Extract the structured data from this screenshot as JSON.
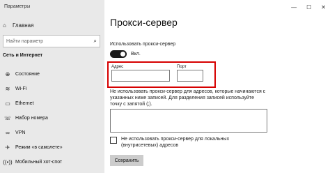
{
  "window": {
    "title": "Параметры",
    "controls": {
      "minimize": "—",
      "maximize": "☐",
      "close": "✕"
    }
  },
  "sidebar": {
    "home": {
      "icon": "home-icon",
      "glyph": "⌂",
      "label": "Главная"
    },
    "search": {
      "placeholder": "Найти параметр",
      "icon": "search-icon"
    },
    "section_title": "Сеть и Интернет",
    "items": [
      {
        "icon": "globe-icon",
        "glyph": "⊕",
        "label": "Состояние"
      },
      {
        "icon": "wifi-icon",
        "glyph": "≋",
        "label": "Wi-Fi"
      },
      {
        "icon": "ethernet-icon",
        "glyph": "▭",
        "label": "Ethernet"
      },
      {
        "icon": "dialup-icon",
        "glyph": "☏",
        "label": "Набор номера"
      },
      {
        "icon": "vpn-icon",
        "glyph": "∞",
        "label": "VPN"
      },
      {
        "icon": "airplane-icon",
        "glyph": "✈",
        "label": "Режим «в самолете»"
      },
      {
        "icon": "hotspot-icon",
        "glyph": "((•))",
        "label": "Мобильный хот-спот"
      }
    ]
  },
  "main": {
    "title": "Прокси-сервер",
    "use_proxy_label": "Использовать прокси-сервер",
    "toggle": {
      "state": "on",
      "label": "Вкл."
    },
    "address": {
      "label": "Адрес",
      "value": ""
    },
    "port": {
      "label": "Порт",
      "value": ""
    },
    "exclude_text": "Не использовать прокси-сервер для адресов, которые начинаются с указанных ниже записей. Для разделения записей используйте точку с запятой (;).",
    "exclude_value": "",
    "local_label": "Не использовать прокси-сервер для локальных (внутрисетевых) адресов",
    "local_checked": false,
    "save_label": "Сохранить"
  },
  "colors": {
    "sidebar_bg": "#e9e9e9",
    "highlight": "#d60000",
    "toggle_on": "#1a1a1a",
    "button_bg": "#cccccc"
  }
}
